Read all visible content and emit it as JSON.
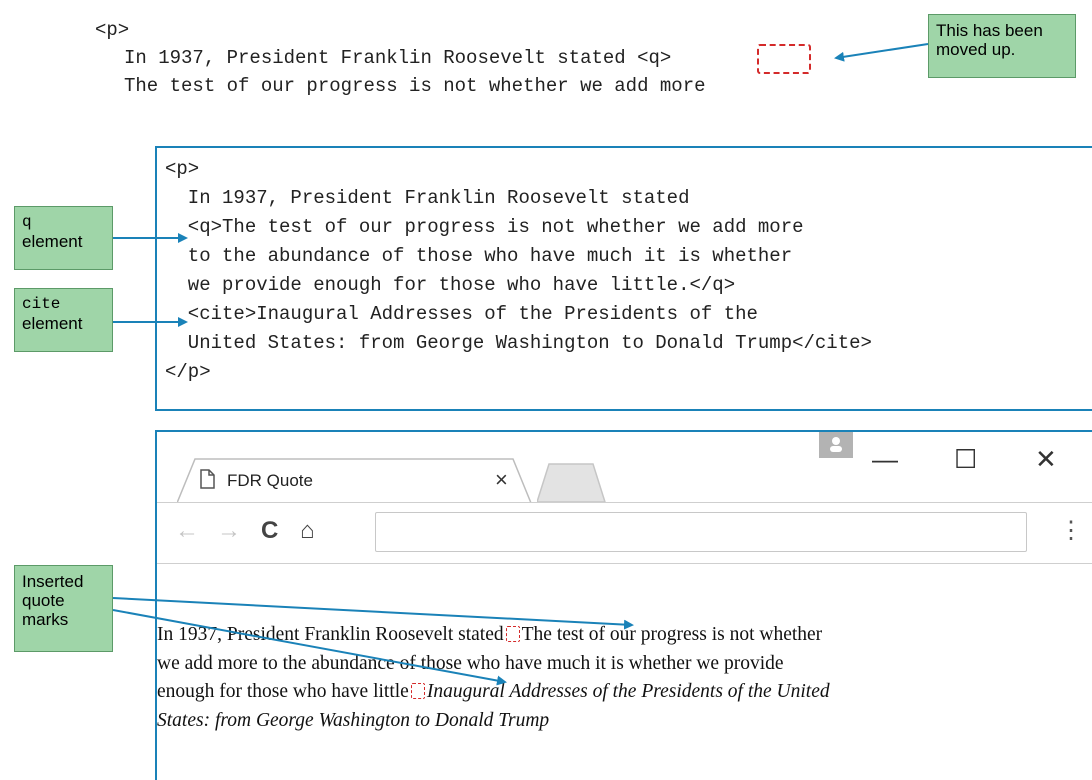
{
  "top_code": {
    "line1": "<p>",
    "line2": "In 1937, President Franklin Roosevelt stated",
    "q_tag": "<q>",
    "line3": "The test of our progress is not whether we add more"
  },
  "callouts": {
    "moved": "This has been moved up.",
    "q_element_code": "q",
    "q_element_word": "element",
    "cite_element_code": "cite",
    "cite_element_word": "element",
    "inserted": "Inserted quote marks"
  },
  "code_box": {
    "lines": [
      "<p>",
      "  In 1937, President Franklin Roosevelt stated",
      "  <q>The test of our progress is not whether we add more",
      "  to the abundance of those who have much it is whether",
      "  we provide enough for those who have little.</q>",
      "  <cite>Inaugural Addresses of the Presidents of the",
      "  United States: from George Washington to Donald Trump</cite>",
      "</p>"
    ]
  },
  "browser": {
    "tab_title": "FDR Quote",
    "tab_close": "×",
    "window_minimize": "—",
    "window_maximize": "☐",
    "window_close": "✕",
    "back": "←",
    "forward": "→",
    "reload": "C",
    "home": "⌂",
    "menu": "⋮",
    "address_value": "",
    "page": {
      "text_before": "In 1937, President Franklin Roosevelt stated",
      "quote_line1": "The test of our progress is not whether",
      "quote_line2": "we add more to the abundance of those who have much it is whether we provide",
      "quote_line3": "enough for those who have little",
      "cite_line1": "Inaugural Addresses of the Presidents of the United",
      "cite_line2": "States: from George Washington to Donald Trump"
    }
  },
  "colors": {
    "accent_blue": "#1a82b8",
    "callout_green": "#9fd5a8",
    "dash_red": "#d42a2a"
  }
}
